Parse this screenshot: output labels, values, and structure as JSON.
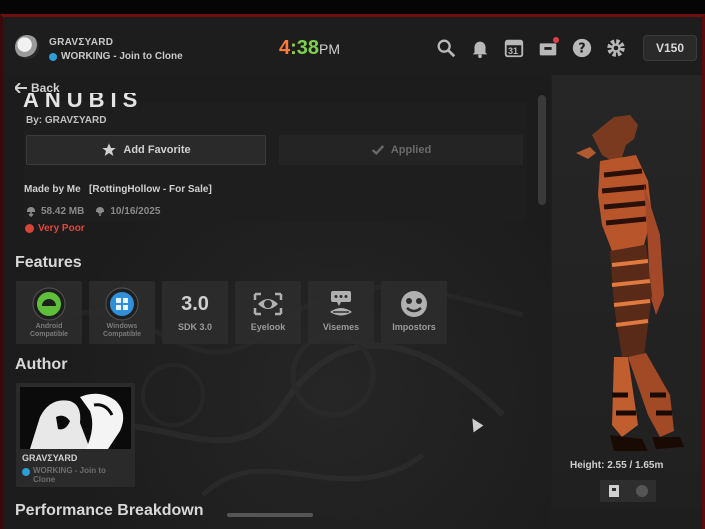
{
  "header": {
    "username": "GRAVΣYARD",
    "status": "WORKING - Join to Clone",
    "clock": {
      "hour": "4",
      "colon": ":",
      "minute": "38",
      "ampm": "PM"
    },
    "icons": [
      "search-icon",
      "bell-icon",
      "calendar-icon",
      "inbox-icon",
      "help-icon",
      "gear-icon"
    ],
    "calendar_day": "31",
    "credits": "V150"
  },
  "nav": {
    "back_label": "Back"
  },
  "avatar": {
    "title": "ANUBIS",
    "by": "By: GRAVΣYARD",
    "favorite_label": "Add Favorite",
    "applied_label": "Applied",
    "made_by": "Made by Me   [RottingHollow - For Sale]",
    "size": "58.42 MB",
    "date": "10/16/2025",
    "performance": "Very Poor"
  },
  "sections": {
    "features": "Features",
    "author": "Author",
    "performance_breakdown": "Performance Breakdown"
  },
  "features": [
    {
      "label": "Android Compatible",
      "icon": "android-icon",
      "color": "#5fbf3a"
    },
    {
      "label": "Windows Compatible",
      "icon": "windows-icon",
      "color": "#2f8fd8"
    },
    {
      "label": "SDK 3.0",
      "icon": "sdk-icon",
      "big": "3.0"
    },
    {
      "label": "Eyelook",
      "icon": "eye-icon"
    },
    {
      "label": "Visemes",
      "icon": "lips-icon"
    },
    {
      "label": "Impostors",
      "icon": "impostor-icon"
    }
  ],
  "author": {
    "name": "GRAVΣYARD",
    "status": "WORKING - Join to Clone"
  },
  "preview": {
    "height": "Height: 2.55 / 1.65m"
  }
}
